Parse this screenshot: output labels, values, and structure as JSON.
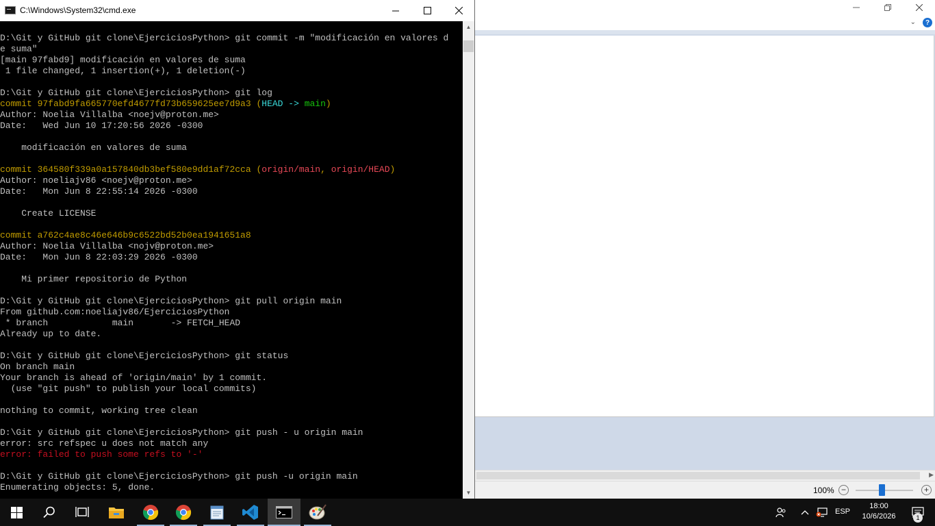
{
  "cmd": {
    "title": "C:\\Windows\\System32\\cmd.exe",
    "lines": [
      [
        {
          "t": "D:\\Git y GitHub git clone\\EjerciciosPython> git commit -m \"modificación en valores d",
          "c": ""
        }
      ],
      [
        {
          "t": "e suma\"",
          "c": ""
        }
      ],
      [
        {
          "t": "[main 97fabd9] modificación en valores de suma",
          "c": ""
        }
      ],
      [
        {
          "t": " 1 file changed, 1 insertion(+), 1 deletion(-)",
          "c": ""
        }
      ],
      [],
      [
        {
          "t": "D:\\Git y GitHub git clone\\EjerciciosPython> git log",
          "c": ""
        }
      ],
      [
        {
          "t": "commit 97fabd9fa665770efd4677fd73b659625ee7d9a3 (",
          "c": "yellow"
        },
        {
          "t": "HEAD -> ",
          "c": "cyan"
        },
        {
          "t": "main",
          "c": "green"
        },
        {
          "t": ")",
          "c": "yellow"
        }
      ],
      [
        {
          "t": "Author: Noelia Villalba <noejv@proton.me>",
          "c": ""
        }
      ],
      [
        {
          "t": "Date:   Wed Jun 10 17:20:56 2026 -0300",
          "c": ""
        }
      ],
      [],
      [
        {
          "t": "    modificación en valores de suma",
          "c": ""
        }
      ],
      [],
      [
        {
          "t": "commit 364580f339a0a157840db3bef580e9dd1af72cca (",
          "c": "yellow"
        },
        {
          "t": "origin/main",
          "c": "red"
        },
        {
          "t": ", ",
          "c": "yellow"
        },
        {
          "t": "origin/HEAD",
          "c": "red"
        },
        {
          "t": ")",
          "c": "yellow"
        }
      ],
      [
        {
          "t": "Author: noeliajv86 <noejv@proton.me>",
          "c": ""
        }
      ],
      [
        {
          "t": "Date:   Mon Jun 8 22:55:14 2026 -0300",
          "c": ""
        }
      ],
      [],
      [
        {
          "t": "    Create LICENSE",
          "c": ""
        }
      ],
      [],
      [
        {
          "t": "commit a762c4ae8c46e646b9c6522bd52b0ea1941651a8",
          "c": "yellow"
        }
      ],
      [
        {
          "t": "Author: Noelia Villalba <nojv@proton.me>",
          "c": ""
        }
      ],
      [
        {
          "t": "Date:   Mon Jun 8 22:03:29 2026 -0300",
          "c": ""
        }
      ],
      [],
      [
        {
          "t": "    Mi primer repositorio de Python",
          "c": ""
        }
      ],
      [],
      [
        {
          "t": "D:\\Git y GitHub git clone\\EjerciciosPython> git pull origin main",
          "c": ""
        }
      ],
      [
        {
          "t": "From github.com:noeliajv86/EjerciciosPython",
          "c": ""
        }
      ],
      [
        {
          "t": " * branch            main       -> FETCH_HEAD",
          "c": ""
        }
      ],
      [
        {
          "t": "Already up to date.",
          "c": ""
        }
      ],
      [],
      [
        {
          "t": "D:\\Git y GitHub git clone\\EjerciciosPython> git status",
          "c": ""
        }
      ],
      [
        {
          "t": "On branch main",
          "c": ""
        }
      ],
      [
        {
          "t": "Your branch is ahead of 'origin/main' by 1 commit.",
          "c": ""
        }
      ],
      [
        {
          "t": "  (use \"git push\" to publish your local commits)",
          "c": ""
        }
      ],
      [],
      [
        {
          "t": "nothing to commit, working tree clean",
          "c": ""
        }
      ],
      [],
      [
        {
          "t": "D:\\Git y GitHub git clone\\EjerciciosPython> git push - u origin main",
          "c": ""
        }
      ],
      [
        {
          "t": "error: src refspec u does not match any",
          "c": ""
        }
      ],
      [
        {
          "t": "error: failed to push some refs to '-'",
          "c": "dred"
        }
      ],
      [],
      [
        {
          "t": "D:\\Git y GitHub git clone\\EjerciciosPython> git push -u origin main",
          "c": ""
        }
      ],
      [
        {
          "t": "Enumerating objects: 5, done.",
          "c": ""
        }
      ]
    ]
  },
  "paint": {
    "zoom": "100%",
    "zoom_level": 0.45
  },
  "taskbar": {
    "items": [
      {
        "name": "start-button",
        "icon": "windows-logo-icon"
      },
      {
        "name": "search-button",
        "icon": "search-icon"
      },
      {
        "name": "task-view-button",
        "icon": "task-view-icon"
      },
      {
        "name": "file-explorer-button",
        "icon": "folder-icon"
      },
      {
        "name": "chrome-button-1",
        "icon": "chrome-icon"
      },
      {
        "name": "chrome-button-2",
        "icon": "chrome-icon"
      },
      {
        "name": "notepad-button",
        "icon": "notepad-icon"
      },
      {
        "name": "vscode-button",
        "icon": "vscode-icon"
      },
      {
        "name": "cmd-button",
        "icon": "cmd-icon"
      },
      {
        "name": "paint-button",
        "icon": "paint-icon"
      }
    ],
    "tray": {
      "language": "ESP",
      "time": "18:00",
      "date": "10/6/2026",
      "notification_count": "1"
    }
  },
  "colors": {
    "yellow": "#c19c00",
    "cyan": "#3ad9d9",
    "green": "#16c60c",
    "red": "#e74856",
    "dark_red": "#c50f1f",
    "taskbar": "#101010",
    "accent": "#1a6fd1"
  }
}
